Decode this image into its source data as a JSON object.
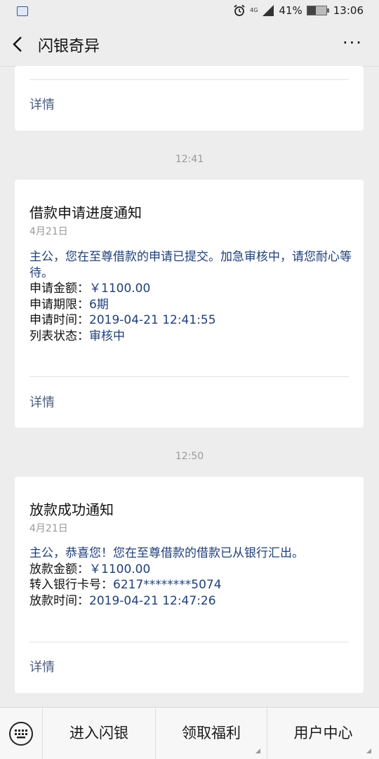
{
  "status": {
    "time": "13:06",
    "battery": "41%",
    "network": "4G"
  },
  "nav": {
    "title": "闪银奇异"
  },
  "cards": [
    {
      "detail": "详情"
    },
    {
      "timestamp": "12:41",
      "title": "借款申请进度通知",
      "date": "4月21日",
      "greeting": "主公，您在至尊借款的申请已提交。加急审核中，请您耐心等待。",
      "rows": [
        {
          "k": "申请金额：",
          "v": "￥1100.00"
        },
        {
          "k": "申请期限：",
          "v": "6期"
        },
        {
          "k": "申请时间：",
          "v": "2019-04-21 12:41:55"
        },
        {
          "k": "列表状态：",
          "v": "审核中"
        }
      ],
      "detail": "详情"
    },
    {
      "timestamp": "12:50",
      "title": "放款成功通知",
      "date": "4月21日",
      "greeting": "主公，恭喜您！您在至尊借款的借款已从银行汇出。",
      "rows": [
        {
          "k": "放款金额：",
          "v": "￥1100.00"
        },
        {
          "k": "转入银行卡号：",
          "v": "6217********5074"
        },
        {
          "k": "放款时间：",
          "v": "2019-04-21 12:47:26"
        }
      ],
      "detail": "详情"
    }
  ],
  "menu": {
    "items": [
      "进入闪银",
      "领取福利",
      "用户中心"
    ]
  }
}
